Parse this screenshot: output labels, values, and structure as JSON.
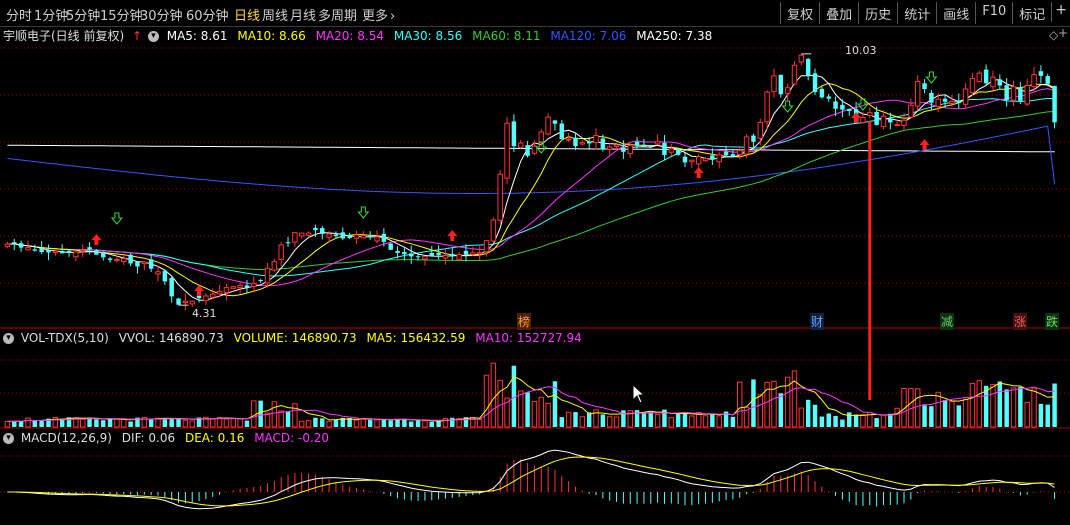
{
  "toolbar": {
    "periods": [
      "分时",
      "1分钟",
      "5分钟",
      "15分钟",
      "30分钟",
      "60分钟",
      "日线",
      "周线",
      "月线",
      "多周期",
      "更多"
    ],
    "active_period": "日线",
    "more_arrow": "›",
    "right_buttons": [
      "复权",
      "叠加",
      "历史",
      "统计",
      "画线",
      "F10",
      "标记"
    ],
    "plus": "+"
  },
  "price_panel": {
    "stock_title": "宇顺电子(日线 前复权)",
    "ma_labels": [
      {
        "text": "MA5: 8.61",
        "color": "#ffffff"
      },
      {
        "text": "MA10: 8.66",
        "color": "#ffff00"
      },
      {
        "text": "MA20: 8.54",
        "color": "#ff33ff"
      },
      {
        "text": "MA30: 8.56",
        "color": "#33ffff"
      },
      {
        "text": "MA60: 8.11",
        "color": "#33cc33"
      },
      {
        "text": "MA120: 7.06",
        "color": "#3355ff"
      },
      {
        "text": "MA250: 7.38",
        "color": "#ffffff"
      }
    ],
    "high_label": "10.03",
    "low_label": "4.31",
    "event_markers": [
      {
        "text": "榜",
        "color": "#ff9933"
      },
      {
        "text": "财",
        "color": "#66aaff"
      },
      {
        "text": "减",
        "color": "#66cc66"
      },
      {
        "text": "涨",
        "color": "#ff5555"
      },
      {
        "text": "跌",
        "color": "#66dd66"
      }
    ]
  },
  "volume_panel": {
    "indicator": "VOL-TDX(5,10)",
    "labels": [
      {
        "text": "VVOL: 146890.73",
        "color": "#dddddd"
      },
      {
        "text": "VOLUME: 146890.73",
        "color": "#ffff00"
      },
      {
        "text": "MA5: 156432.59",
        "color": "#ffff00"
      },
      {
        "text": "MA10: 152727.94",
        "color": "#ff33ff"
      }
    ]
  },
  "macd_panel": {
    "indicator": "MACD(12,26,9)",
    "labels": [
      {
        "text": "DIF: 0.06",
        "color": "#dddddd"
      },
      {
        "text": "DEA: 0.16",
        "color": "#ffff00"
      },
      {
        "text": "MACD: -0.20",
        "color": "#ff33ff"
      }
    ]
  },
  "colors": {
    "up": "#ff3333",
    "down": "#54ffff",
    "grid": "#a00000",
    "ma5": "#ffffff",
    "ma10": "#ffff00",
    "ma20": "#ff33ff",
    "ma30": "#33ffff",
    "ma60": "#33cc33",
    "ma120": "#3355ff",
    "ma250": "#ffffff"
  },
  "chart_data": {
    "type": "candlestick",
    "close": [
      5.7,
      5.71,
      5.62,
      5.62,
      5.55,
      5.52,
      5.51,
      5.54,
      5.49,
      5.5,
      5.52,
      5.56,
      5.58,
      5.46,
      5.4,
      5.34,
      5.35,
      5.37,
      5.26,
      5.19,
      5.29,
      5.14,
      5.07,
      4.85,
      4.51,
      4.32,
      4.4,
      4.4,
      4.47,
      4.52,
      4.56,
      4.62,
      4.71,
      4.73,
      4.76,
      4.71,
      4.8,
      4.86,
      5.15,
      5.3,
      5.68,
      5.72,
      5.96,
      5.95,
      5.95,
      6.02,
      5.93,
      5.93,
      5.88,
      5.83,
      5.84,
      5.91,
      5.89,
      5.85,
      5.86,
      5.75,
      5.57,
      5.5,
      5.47,
      5.42,
      5.4,
      5.42,
      5.42,
      5.45,
      5.44,
      5.43,
      5.46,
      5.46,
      5.5,
      5.51,
      5.78,
      6.25,
      7.29,
      8.45,
      7.93,
      8.0,
      7.71,
      7.93,
      8.25,
      8.59,
      8.44,
      8.09,
      8.09,
      7.93,
      8.01,
      7.99,
      8.17,
      7.86,
      7.91,
      7.96,
      7.8,
      7.95,
      7.94,
      7.92,
      7.92,
      8.03,
      7.73,
      7.87,
      7.73,
      7.56,
      7.61,
      7.69,
      7.65,
      7.63,
      7.73,
      7.72,
      7.69,
      7.83,
      8.14,
      8.03,
      8.47,
      9.16,
      9.53,
      9.11,
      9.26,
      9.77,
      10.0,
      9.53,
      9.16,
      9.04,
      9.01,
      8.78,
      8.76,
      8.73,
      8.45,
      8.58,
      8.69,
      8.41,
      8.61,
      8.47,
      8.42,
      8.52,
      8.86,
      9.4,
      9.23,
      8.92,
      9.0,
      8.94,
      8.95,
      8.91,
      9.23,
      9.47,
      9.59,
      9.36,
      9.5,
      9.31,
      8.98,
      9.28,
      8.96,
      9.31,
      9.56,
      9.53,
      9.35,
      8.47
    ],
    "ylim": [
      4.2,
      10.3
    ],
    "ma_values": {
      "MA5": 8.61,
      "MA10": 8.66,
      "MA20": 8.54,
      "MA30": 8.56,
      "MA60": 8.11,
      "MA120": 7.06,
      "MA250": 7.38
    },
    "high": 10.03,
    "low": 4.31,
    "volume_last": 146890.73,
    "volume_ma5": 156432.59,
    "volume_ma10": 152727.94,
    "macd": {
      "dif": 0.06,
      "dea": 0.16,
      "macd": -0.2
    }
  }
}
